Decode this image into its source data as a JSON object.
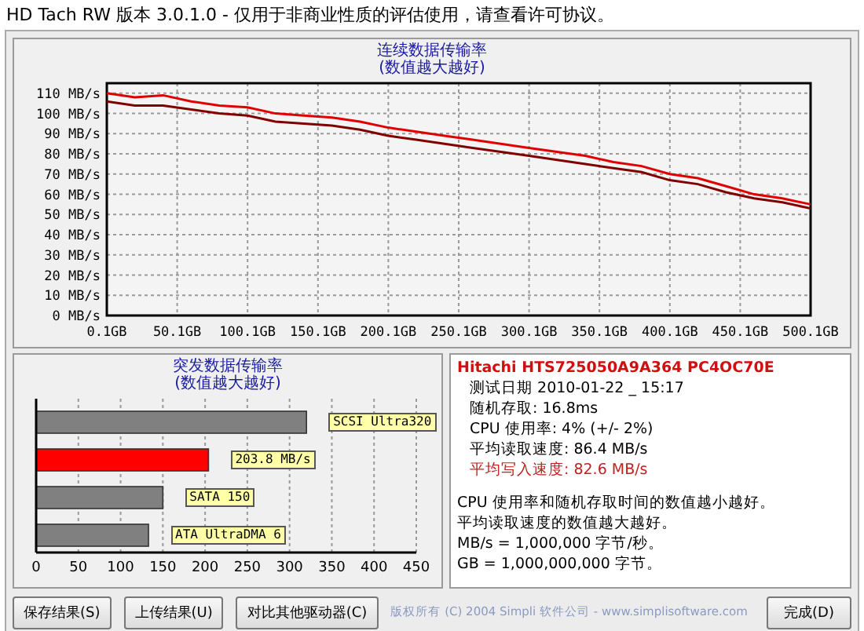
{
  "window": {
    "title": "HD Tach RW 版本 3.0.1.0  - 仅用于非商业性质的评估使用，请查看许可协议。"
  },
  "sequential": {
    "subtitle": "(数值越大越好)",
    "chart_data": {
      "type": "line",
      "title": "连续数据传输率",
      "x": [
        0.1,
        20,
        40,
        60,
        80,
        100,
        120,
        140,
        160,
        180,
        200,
        220,
        240,
        260,
        280,
        300,
        320,
        340,
        360,
        380,
        400,
        420,
        440,
        460,
        480,
        500.1
      ],
      "series": [
        {
          "color": "#e00000",
          "values": [
            110,
            108,
            109,
            106,
            104,
            103,
            100,
            99,
            98,
            96,
            93,
            91,
            89,
            87,
            85,
            83,
            81,
            79,
            76,
            74,
            70,
            68,
            64,
            60,
            58,
            55
          ]
        },
        {
          "color": "#800000",
          "values": [
            106,
            104,
            104,
            102,
            100,
            99,
            96,
            95,
            94,
            92,
            89,
            87,
            85,
            83,
            81,
            79,
            77,
            75,
            73,
            71,
            67,
            65,
            61,
            58,
            56,
            53
          ]
        }
      ],
      "xlim": [
        0.1,
        500.1
      ],
      "ylim": [
        0,
        115
      ],
      "grid": true,
      "xticks": [
        {
          "value": 0.1,
          "label": "0.1GB"
        },
        {
          "value": 50.1,
          "label": "50.1GB"
        },
        {
          "value": 100.1,
          "label": "100.1GB"
        },
        {
          "value": 150.1,
          "label": "150.1GB"
        },
        {
          "value": 200.1,
          "label": "200.1GB"
        },
        {
          "value": 250.1,
          "label": "250.1GB"
        },
        {
          "value": 300.1,
          "label": "300.1GB"
        },
        {
          "value": 350.1,
          "label": "350.1GB"
        },
        {
          "value": 400.1,
          "label": "400.1GB"
        },
        {
          "value": 450.1,
          "label": "450.1GB"
        },
        {
          "value": 500.1,
          "label": "500.1GB"
        }
      ],
      "yticks": [
        {
          "value": 0,
          "label": "0 MB/s"
        },
        {
          "value": 10,
          "label": "10 MB/s"
        },
        {
          "value": 20,
          "label": "20 MB/s"
        },
        {
          "value": 30,
          "label": "30 MB/s"
        },
        {
          "value": 40,
          "label": "40 MB/s"
        },
        {
          "value": 50,
          "label": "50 MB/s"
        },
        {
          "value": 60,
          "label": "60 MB/s"
        },
        {
          "value": 70,
          "label": "70 MB/s"
        },
        {
          "value": 80,
          "label": "80 MB/s"
        },
        {
          "value": 90,
          "label": "90 MB/s"
        },
        {
          "value": 100,
          "label": "100 MB/s"
        },
        {
          "value": 110,
          "label": "110 MB/s"
        }
      ]
    }
  },
  "burst": {
    "subtitle": "(数值越大越好)",
    "chart_data": {
      "type": "bar",
      "orientation": "horizontal",
      "title": "突发数据传输率",
      "series": [
        {
          "color": "#808080",
          "values": [
            320,
            null,
            150,
            133
          ]
        },
        {
          "color": "#ff0000",
          "values": [
            null,
            204,
            null,
            null
          ]
        }
      ],
      "xlim": [
        0,
        450
      ],
      "xticks": [
        0,
        50,
        100,
        150,
        200,
        250,
        300,
        350,
        400,
        450
      ],
      "grid": true,
      "annotations": [
        {
          "text": "SCSI Ultra320"
        },
        {
          "text": "203.8 MB/s"
        },
        {
          "text": "SATA 150"
        },
        {
          "text": "ATA UltraDMA 6"
        }
      ]
    }
  },
  "info": {
    "drive": "Hitachi HTS725050A9A364 PC4OC70E",
    "lines": [
      {
        "text": "测试日期 2010-01-22 _ 15:17",
        "kind": "normal"
      },
      {
        "text": "随机存取: 16.8ms",
        "kind": "normal"
      },
      {
        "text": "CPU 使用率: 4% (+/- 2%)",
        "kind": "normal"
      },
      {
        "text": "平均读取速度: 86.4 MB/s",
        "kind": "normal"
      },
      {
        "text": "平均写入速度: 82.6 MB/s",
        "kind": "write"
      }
    ],
    "notes": [
      "CPU 使用率和随机存取时间的数值越小越好。",
      "平均读取速度的数值越大越好。",
      "MB/s = 1,000,000 字节/秒。",
      "GB = 1,000,000,000 字节。"
    ]
  },
  "buttons": [
    "保存结果(S)",
    "上传结果(U)",
    "对比其他驱动器(C)"
  ],
  "copyright": "版权所有 (C) 2004 Simpli 软件公司 - www.simplisoftware.com",
  "done_button": "完成(D)"
}
